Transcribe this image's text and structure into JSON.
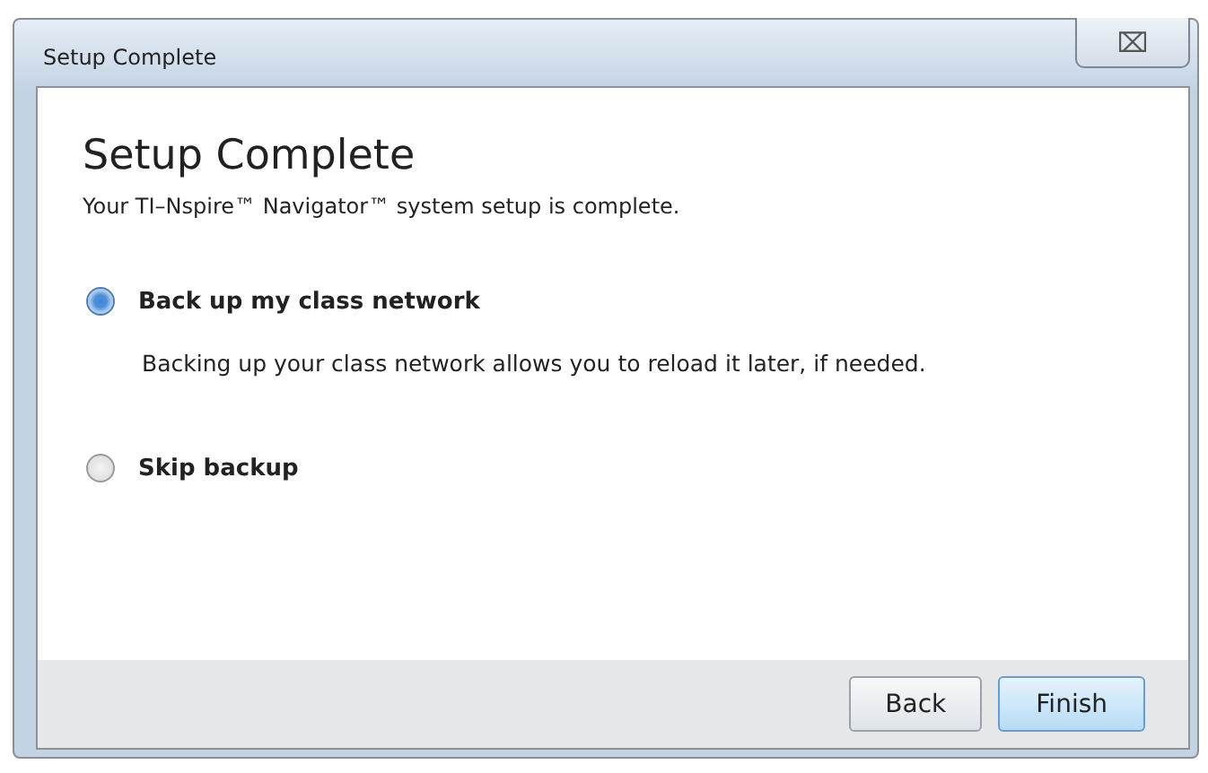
{
  "window": {
    "title": "Setup Complete",
    "close": "⌧"
  },
  "heading": "Setup Complete",
  "subtitle": "Your TI–Nspire™ Navigator™ system setup is complete.",
  "options": [
    {
      "label": "Back up my class network",
      "selected": true,
      "description": "Backing up your class network allows you to reload it later, if needed."
    },
    {
      "label": "Skip backup",
      "selected": false
    }
  ],
  "buttons": [
    {
      "label": "Back",
      "default": false
    },
    {
      "label": "Finish",
      "default": true
    }
  ]
}
